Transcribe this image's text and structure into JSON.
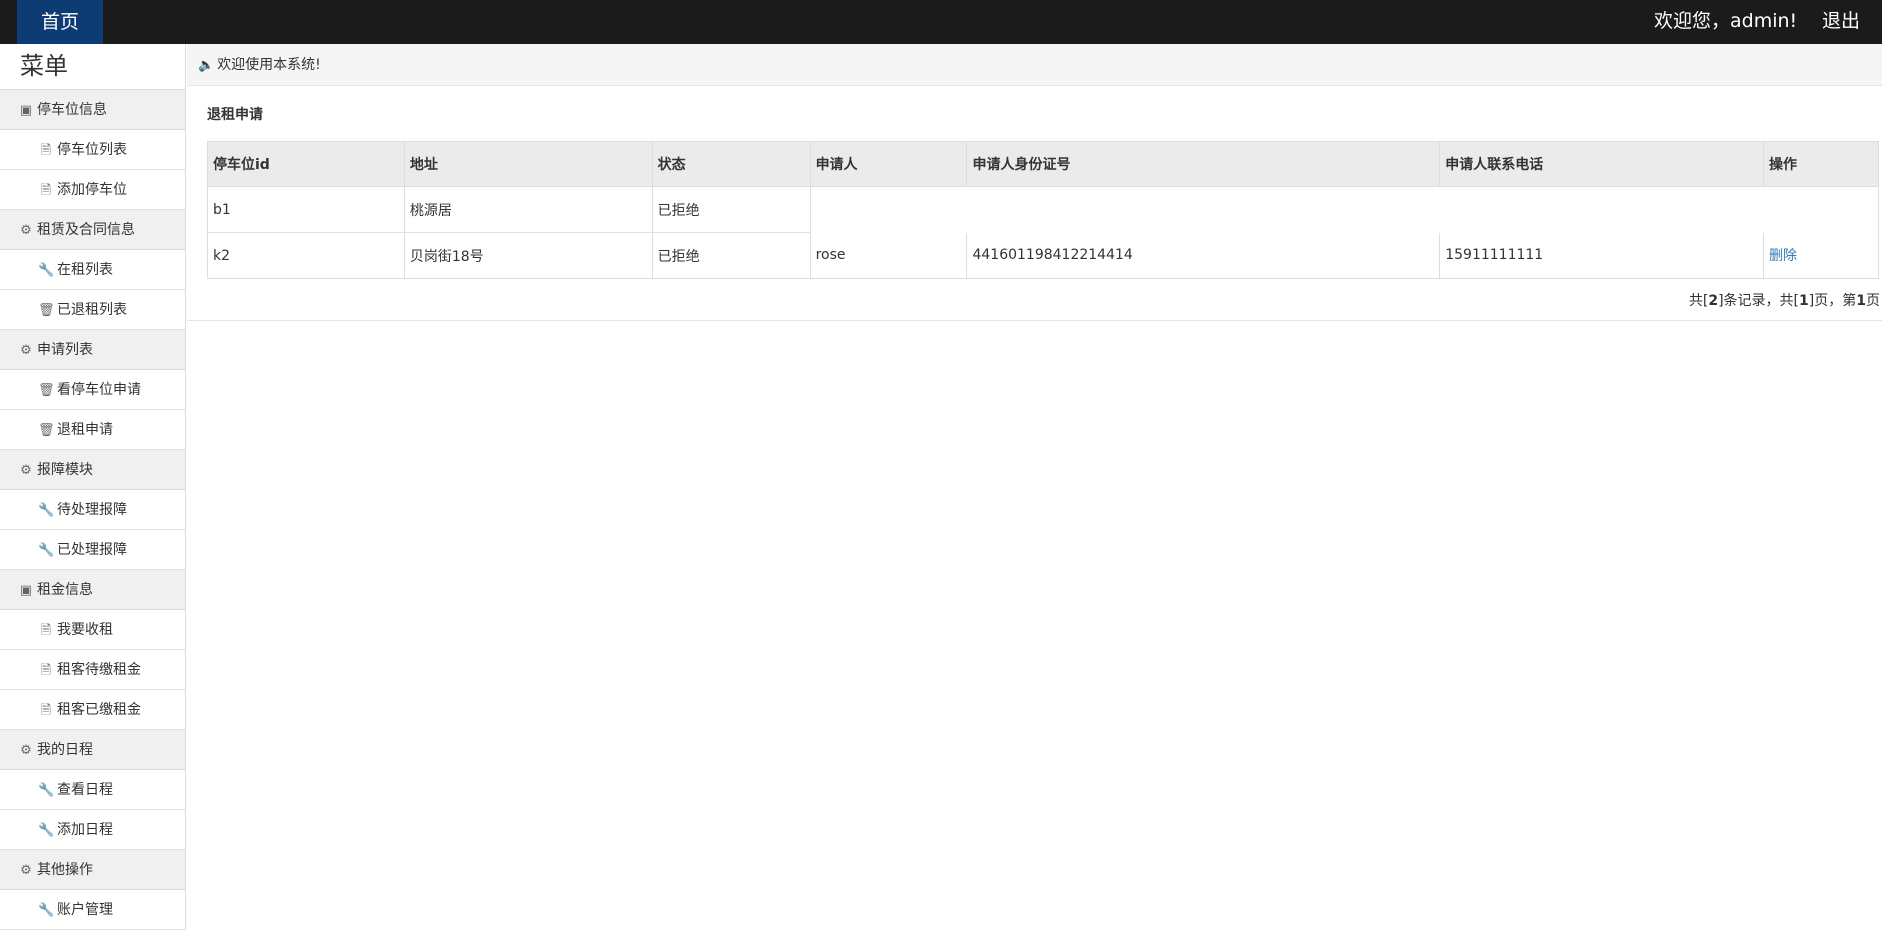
{
  "header": {
    "home_label": "首页",
    "welcome_text": "欢迎您，admin!",
    "logout_label": "退出"
  },
  "sidebar": {
    "title": "菜单",
    "groups": [
      {
        "label": "停车位信息",
        "icon": "address-card-icon",
        "items": [
          {
            "label": "停车位列表",
            "icon": "file-icon"
          },
          {
            "label": "添加停车位",
            "icon": "file-icon"
          }
        ]
      },
      {
        "label": "租赁及合同信息",
        "icon": "gear-icon",
        "items": [
          {
            "label": "在租列表",
            "icon": "wrench-icon"
          },
          {
            "label": "已退租列表",
            "icon": "trash-icon"
          }
        ]
      },
      {
        "label": "申请列表",
        "icon": "gear-icon",
        "items": [
          {
            "label": "看停车位申请",
            "icon": "trash-icon"
          },
          {
            "label": "退租申请",
            "icon": "trash-icon"
          }
        ]
      },
      {
        "label": "报障模块",
        "icon": "gear-icon",
        "items": [
          {
            "label": "待处理报障",
            "icon": "wrench-icon"
          },
          {
            "label": "已处理报障",
            "icon": "wrench-icon"
          }
        ]
      },
      {
        "label": "租金信息",
        "icon": "address-card-icon",
        "items": [
          {
            "label": "我要收租",
            "icon": "file-icon"
          },
          {
            "label": "租客待缴租金",
            "icon": "file-icon"
          },
          {
            "label": "租客已缴租金",
            "icon": "file-icon"
          }
        ]
      },
      {
        "label": "我的日程",
        "icon": "gear-icon",
        "items": [
          {
            "label": "查看日程",
            "icon": "wrench-icon"
          },
          {
            "label": "添加日程",
            "icon": "wrench-icon"
          }
        ]
      },
      {
        "label": "其他操作",
        "icon": "gear-icon",
        "items": [
          {
            "label": "账户管理",
            "icon": "wrench-icon"
          }
        ]
      }
    ]
  },
  "notice": {
    "icon": "volume-icon",
    "text": "欢迎使用本系统!"
  },
  "main": {
    "section_title": "退租申请",
    "columns": [
      "停车位id",
      "地址",
      "状态",
      "申请人",
      "申请人身份证号",
      "申请人联系电话",
      "操作"
    ],
    "rows": [
      {
        "id": "b1",
        "address": "桃源居",
        "status": "已拒绝",
        "applicant": "",
        "id_number": "",
        "phone": "",
        "action": ""
      },
      {
        "id": "k2",
        "address": "贝岗街18号",
        "status": "已拒绝",
        "applicant": "rose",
        "id_number": "441601198412214414",
        "phone": "15911111111",
        "action": "删除"
      }
    ],
    "pager": {
      "p1": "共[",
      "total_records": "2",
      "p2": "]条记录，共[",
      "total_pages": "1",
      "p3": "]页，第",
      "current_page": "1",
      "p4": "页"
    }
  },
  "colors": {
    "topbar": "#1b1b1b",
    "home_tab": "#0d3b73",
    "link": "#337ab7",
    "group_bg": "#f0f0f0",
    "table_header_bg": "#ebebeb"
  }
}
